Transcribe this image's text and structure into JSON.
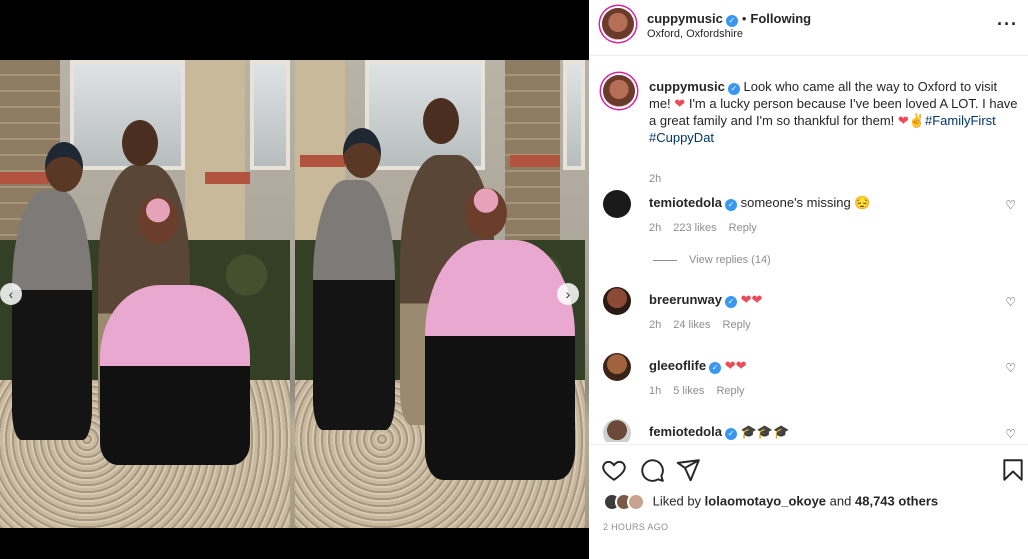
{
  "post": {
    "username": "cuppymusic",
    "follow_status": "Following",
    "location": "Oxford, Oxfordshire",
    "more_icon": "more-horizontal-icon"
  },
  "caption": {
    "username": "cuppymusic",
    "text_1": "Look who came all the way to Oxford to visit me!",
    "text_2": "I'm a lucky person because I've been loved A LOT. I have a great family and I'm so thankful for them!",
    "hashtag_1": "#FamilyFirst",
    "hashtag_2": "#CuppyDat",
    "time": "2h"
  },
  "comments": [
    {
      "username": "temiotedola",
      "text": "someone's missing",
      "emoji": "😔",
      "time": "2h",
      "likes": "223 likes",
      "reply": "Reply"
    },
    {
      "username": "breerunway",
      "text": "",
      "emoji": "❤❤",
      "time": "2h",
      "likes": "24 likes",
      "reply": "Reply"
    },
    {
      "username": "gleeoflife",
      "text": "",
      "emoji": "❤❤",
      "time": "1h",
      "likes": "5 likes",
      "reply": "Reply"
    },
    {
      "username": "femiotedola",
      "text": "",
      "emoji": "🎓🎓🎓",
      "time": "",
      "likes": "",
      "reply": ""
    }
  ],
  "view_replies": "View replies (14)",
  "actions": {
    "like_icon": "heart-icon",
    "comment_icon": "comment-icon",
    "share_icon": "send-icon",
    "save_icon": "bookmark-icon"
  },
  "liked_by": {
    "prefix": "Liked by",
    "user": "lolaomotayo_okoye",
    "connector": "and",
    "count": "48,743 others"
  },
  "timestamp": "2 HOURS AGO",
  "colors": {
    "verified": "#3897f0",
    "heart": "#ed4956",
    "hashtag": "#00376b",
    "meta": "#8e8e8e"
  }
}
